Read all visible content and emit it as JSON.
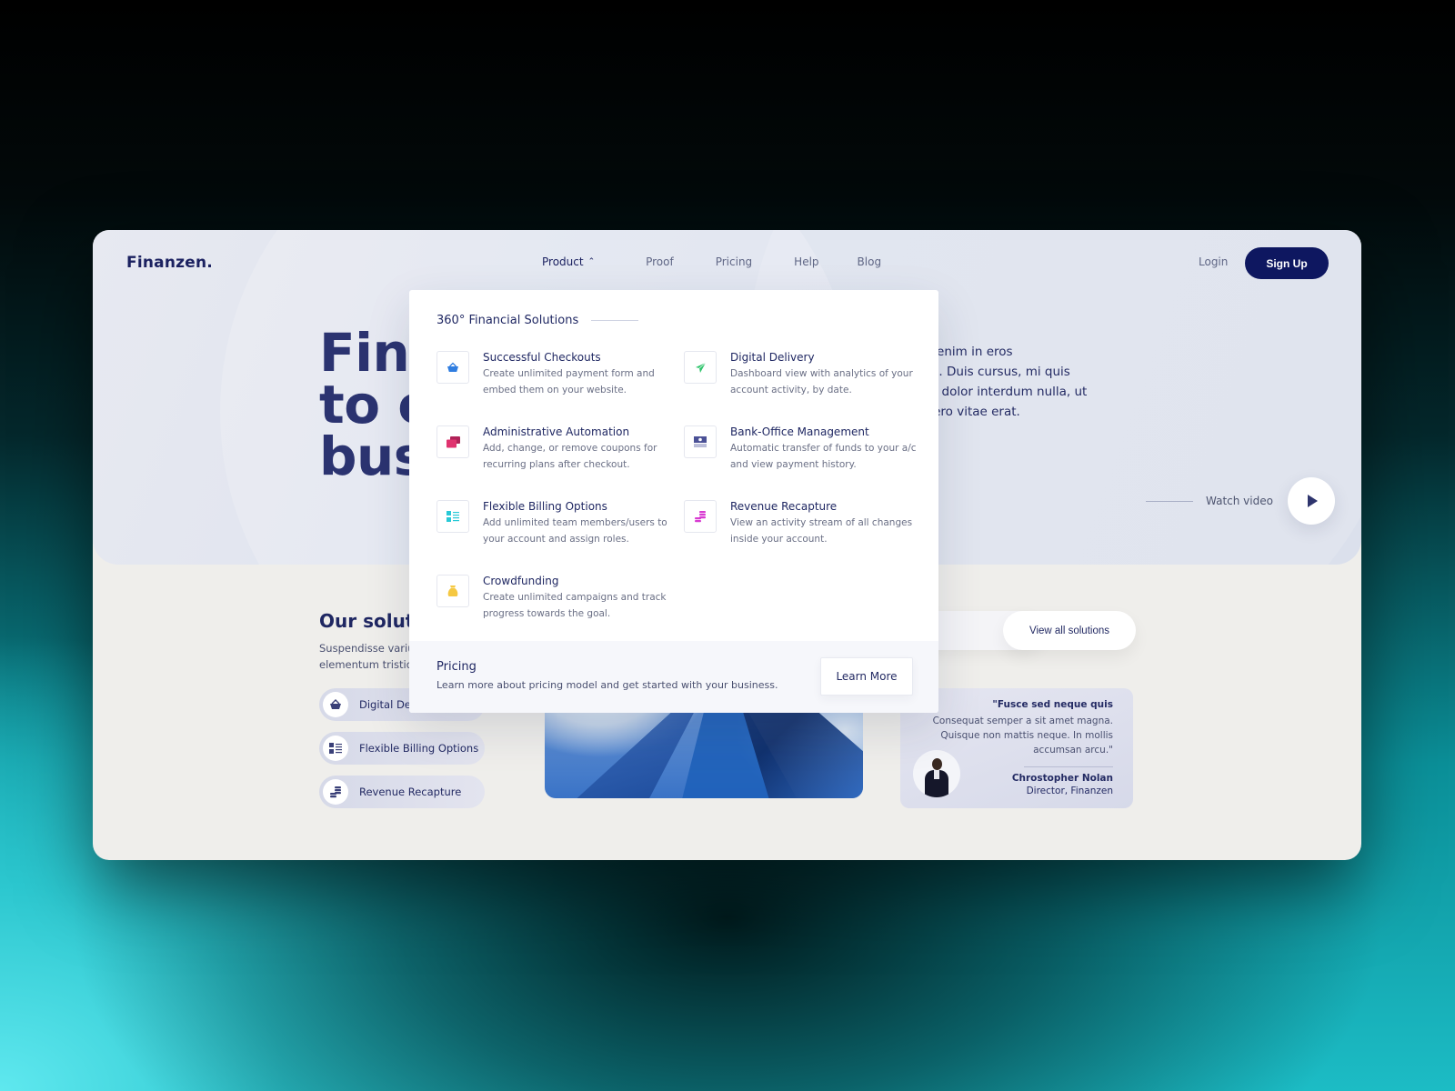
{
  "brand": {
    "logo": "Finanzen."
  },
  "nav": {
    "items": [
      {
        "label": "Product",
        "active": true,
        "expanded": true
      },
      {
        "label": "Proof"
      },
      {
        "label": "Pricing"
      },
      {
        "label": "Help"
      },
      {
        "label": "Blog"
      }
    ],
    "login": "Login",
    "signup": "Sign Up",
    "chevron_up": "⌃"
  },
  "hero": {
    "title_visible": "Fin\nto c\nbus",
    "text_visible": "e varius enim in eros\n tristique. Duis cursus, mi quis\nare, eros dolor interdum nulla, ut\ndiam libero vitae erat.",
    "watch_label": "Watch video"
  },
  "dropdown": {
    "heading": "360° Financial Solutions",
    "items": [
      {
        "title": "Successful Checkouts",
        "desc": "Create unlimited payment form and embed them on your website.",
        "icon": "basket-icon",
        "color": "#2f7de0"
      },
      {
        "title": "Digital Delivery",
        "desc": "Dashboard view with analytics of your account activity, by date.",
        "icon": "paper-plane-icon",
        "color": "#2ec46b"
      },
      {
        "title": "Administrative Automation",
        "desc": "Add, change, or remove coupons for recurring plans after checkout.",
        "icon": "stacked-cards-icon",
        "color": "#e0336f"
      },
      {
        "title": "Bank-Office Management",
        "desc": "Automatic transfer of funds to your a/c and view payment history.",
        "icon": "banknote-icon",
        "color": "#4b5196"
      },
      {
        "title": "Flexible Billing Options",
        "desc": "Add unlimited team members/users to your account and assign roles.",
        "icon": "list-layout-icon",
        "color": "#28c9d6"
      },
      {
        "title": "Revenue Recapture",
        "desc": "View an activity stream of all changes inside your account.",
        "icon": "coins-icon",
        "color": "#d83bd1"
      },
      {
        "title": "Crowdfunding",
        "desc": "Create unlimited campaigns and track progress towards the goal.",
        "icon": "money-bag-icon",
        "color": "#f5c842"
      }
    ],
    "footer": {
      "title": "Pricing",
      "desc": "Learn more about pricing model and get started with your business.",
      "button": "Learn More"
    }
  },
  "solutions": {
    "title_visible": "Our soluti",
    "desc_visible": "Suspendisse variu\nelementum tristiq",
    "pills": [
      {
        "label": "Digital Delivery",
        "icon": "basket-icon"
      },
      {
        "label": "Flexible Billing Options",
        "icon": "list-layout-icon"
      },
      {
        "label": "Revenue Recapture",
        "icon": "coins-icon"
      }
    ],
    "view_all": "View all solutions"
  },
  "testimonial": {
    "lead": "\"Fusce sed neque quis",
    "quote": "Consequat semper a sit amet magna. Quisque non mattis neque. In mollis accumsan arcu.\"",
    "name": "Chrostopher Nolan",
    "role": "Director, Finanzen"
  },
  "colors": {
    "brand_navy": "#0e1760",
    "text_navy": "#1f2762",
    "hero_bg": "#dde2ee",
    "lower_bg": "#efeeeb"
  }
}
